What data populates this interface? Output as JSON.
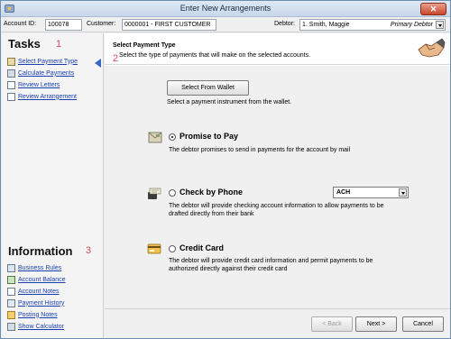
{
  "window": {
    "title": "Enter New Arrangements",
    "close_glyph": "✕"
  },
  "header": {
    "account_id_label": "Account ID:",
    "account_id_value": "100078",
    "customer_label": "Customer:",
    "customer_value": "0000001 - FIRST CUSTOMER",
    "debtor_label": "Debtor:",
    "debtor_value": "1. Smith, Maggie",
    "debtor_role": "Primary Debtor"
  },
  "sidebar": {
    "tasks_title": "Tasks",
    "tasks_number": "1",
    "tasks": [
      {
        "label": "Select Payment Type",
        "icon": "payment-type-icon"
      },
      {
        "label": "Calculate Payments",
        "icon": "calculator-icon"
      },
      {
        "label": "Review Letters",
        "icon": "letter-icon"
      },
      {
        "label": "Review Arrangement",
        "icon": "checklist-icon"
      }
    ],
    "info_title": "Information",
    "info_number": "3",
    "info": [
      {
        "label": "Business Rules",
        "icon": "rules-icon"
      },
      {
        "label": "Account Balance",
        "icon": "balance-icon"
      },
      {
        "label": "Account Notes",
        "icon": "notes-icon"
      },
      {
        "label": "Payment History",
        "icon": "history-icon"
      },
      {
        "label": "Posting Notes",
        "icon": "folder-icon"
      },
      {
        "label": "Show Calculator",
        "icon": "calculator-icon"
      }
    ]
  },
  "main": {
    "title": "Select Payment Type",
    "description": "Select the type of payments that will make on the selected accounts.",
    "step_number": "2",
    "wallet_button": "Select From Wallet",
    "wallet_description": "Select a payment instrument from the wallet.",
    "options": [
      {
        "title": "Promise to Pay",
        "description": "The debtor promises to send in payments for the account by mail",
        "selected": true,
        "icon": "mail-icon"
      },
      {
        "title": "Check by Phone",
        "description_line1": "The debtor will provide checking account information to allow payments to be",
        "description_line2": "drafted directly from their bank",
        "selected": false,
        "icon": "phone-check-icon",
        "select_value": "ACH"
      },
      {
        "title": "Credit Card",
        "description_line1": "The debtor will provide credit card information and permit payments to be",
        "description_line2": "authorized directly against their credit card",
        "selected": false,
        "icon": "credit-card-icon"
      }
    ],
    "back_button": "< Back",
    "next_button": "Next >",
    "cancel_button": "Cancel"
  },
  "colors": {
    "accent_link": "#1a3fb3",
    "step_number": "#d4475a",
    "marker": "#3a66c4"
  }
}
